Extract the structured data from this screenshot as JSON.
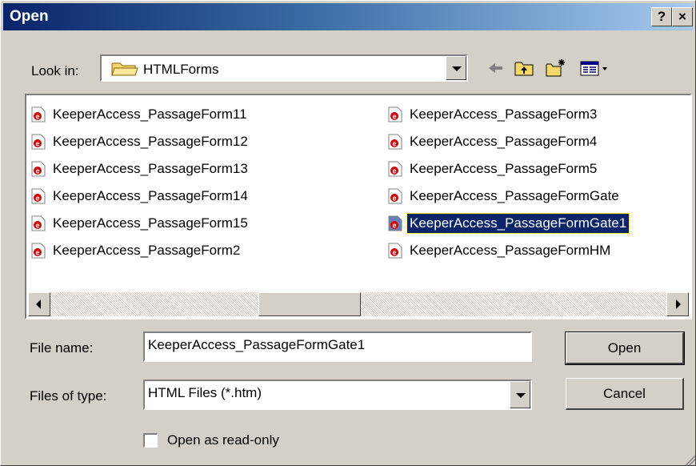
{
  "window": {
    "title": "Open",
    "help_label": "?",
    "close_label": "×"
  },
  "lookin": {
    "label": "Look in:",
    "value": "HTMLForms"
  },
  "toolbar": {
    "back": "back-arrow-icon",
    "up": "up-one-level-icon",
    "new_folder": "new-folder-icon",
    "view_menu": "view-menu-icon"
  },
  "files": [
    {
      "name": "KeeperAccess_PassageForm11",
      "selected": false
    },
    {
      "name": "KeeperAccess_PassageForm12",
      "selected": false
    },
    {
      "name": "KeeperAccess_PassageForm13",
      "selected": false
    },
    {
      "name": "KeeperAccess_PassageForm14",
      "selected": false
    },
    {
      "name": "KeeperAccess_PassageForm15",
      "selected": false
    },
    {
      "name": "KeeperAccess_PassageForm2",
      "selected": false
    },
    {
      "name": "KeeperAccess_PassageForm3",
      "selected": false
    },
    {
      "name": "KeeperAccess_PassageForm4",
      "selected": false
    },
    {
      "name": "KeeperAccess_PassageForm5",
      "selected": false
    },
    {
      "name": "KeeperAccess_PassageFormGate",
      "selected": false
    },
    {
      "name": "KeeperAccess_PassageFormGate1",
      "selected": true
    },
    {
      "name": "KeeperAccess_PassageFormHM",
      "selected": false
    }
  ],
  "filename": {
    "label": "File name:",
    "value": "KeeperAccess_PassageFormGate1"
  },
  "filetype": {
    "label": "Files of type:",
    "value": "HTML Files (*.htm)"
  },
  "buttons": {
    "open": "Open",
    "cancel": "Cancel"
  },
  "readonly": {
    "label": "Open as read-only",
    "checked": false
  },
  "colors": {
    "title_start": "#0a246a",
    "title_end": "#a6caf0",
    "selection": "#0a246a",
    "file_icon_red": "#d40000",
    "face": "#d4d0c8"
  }
}
